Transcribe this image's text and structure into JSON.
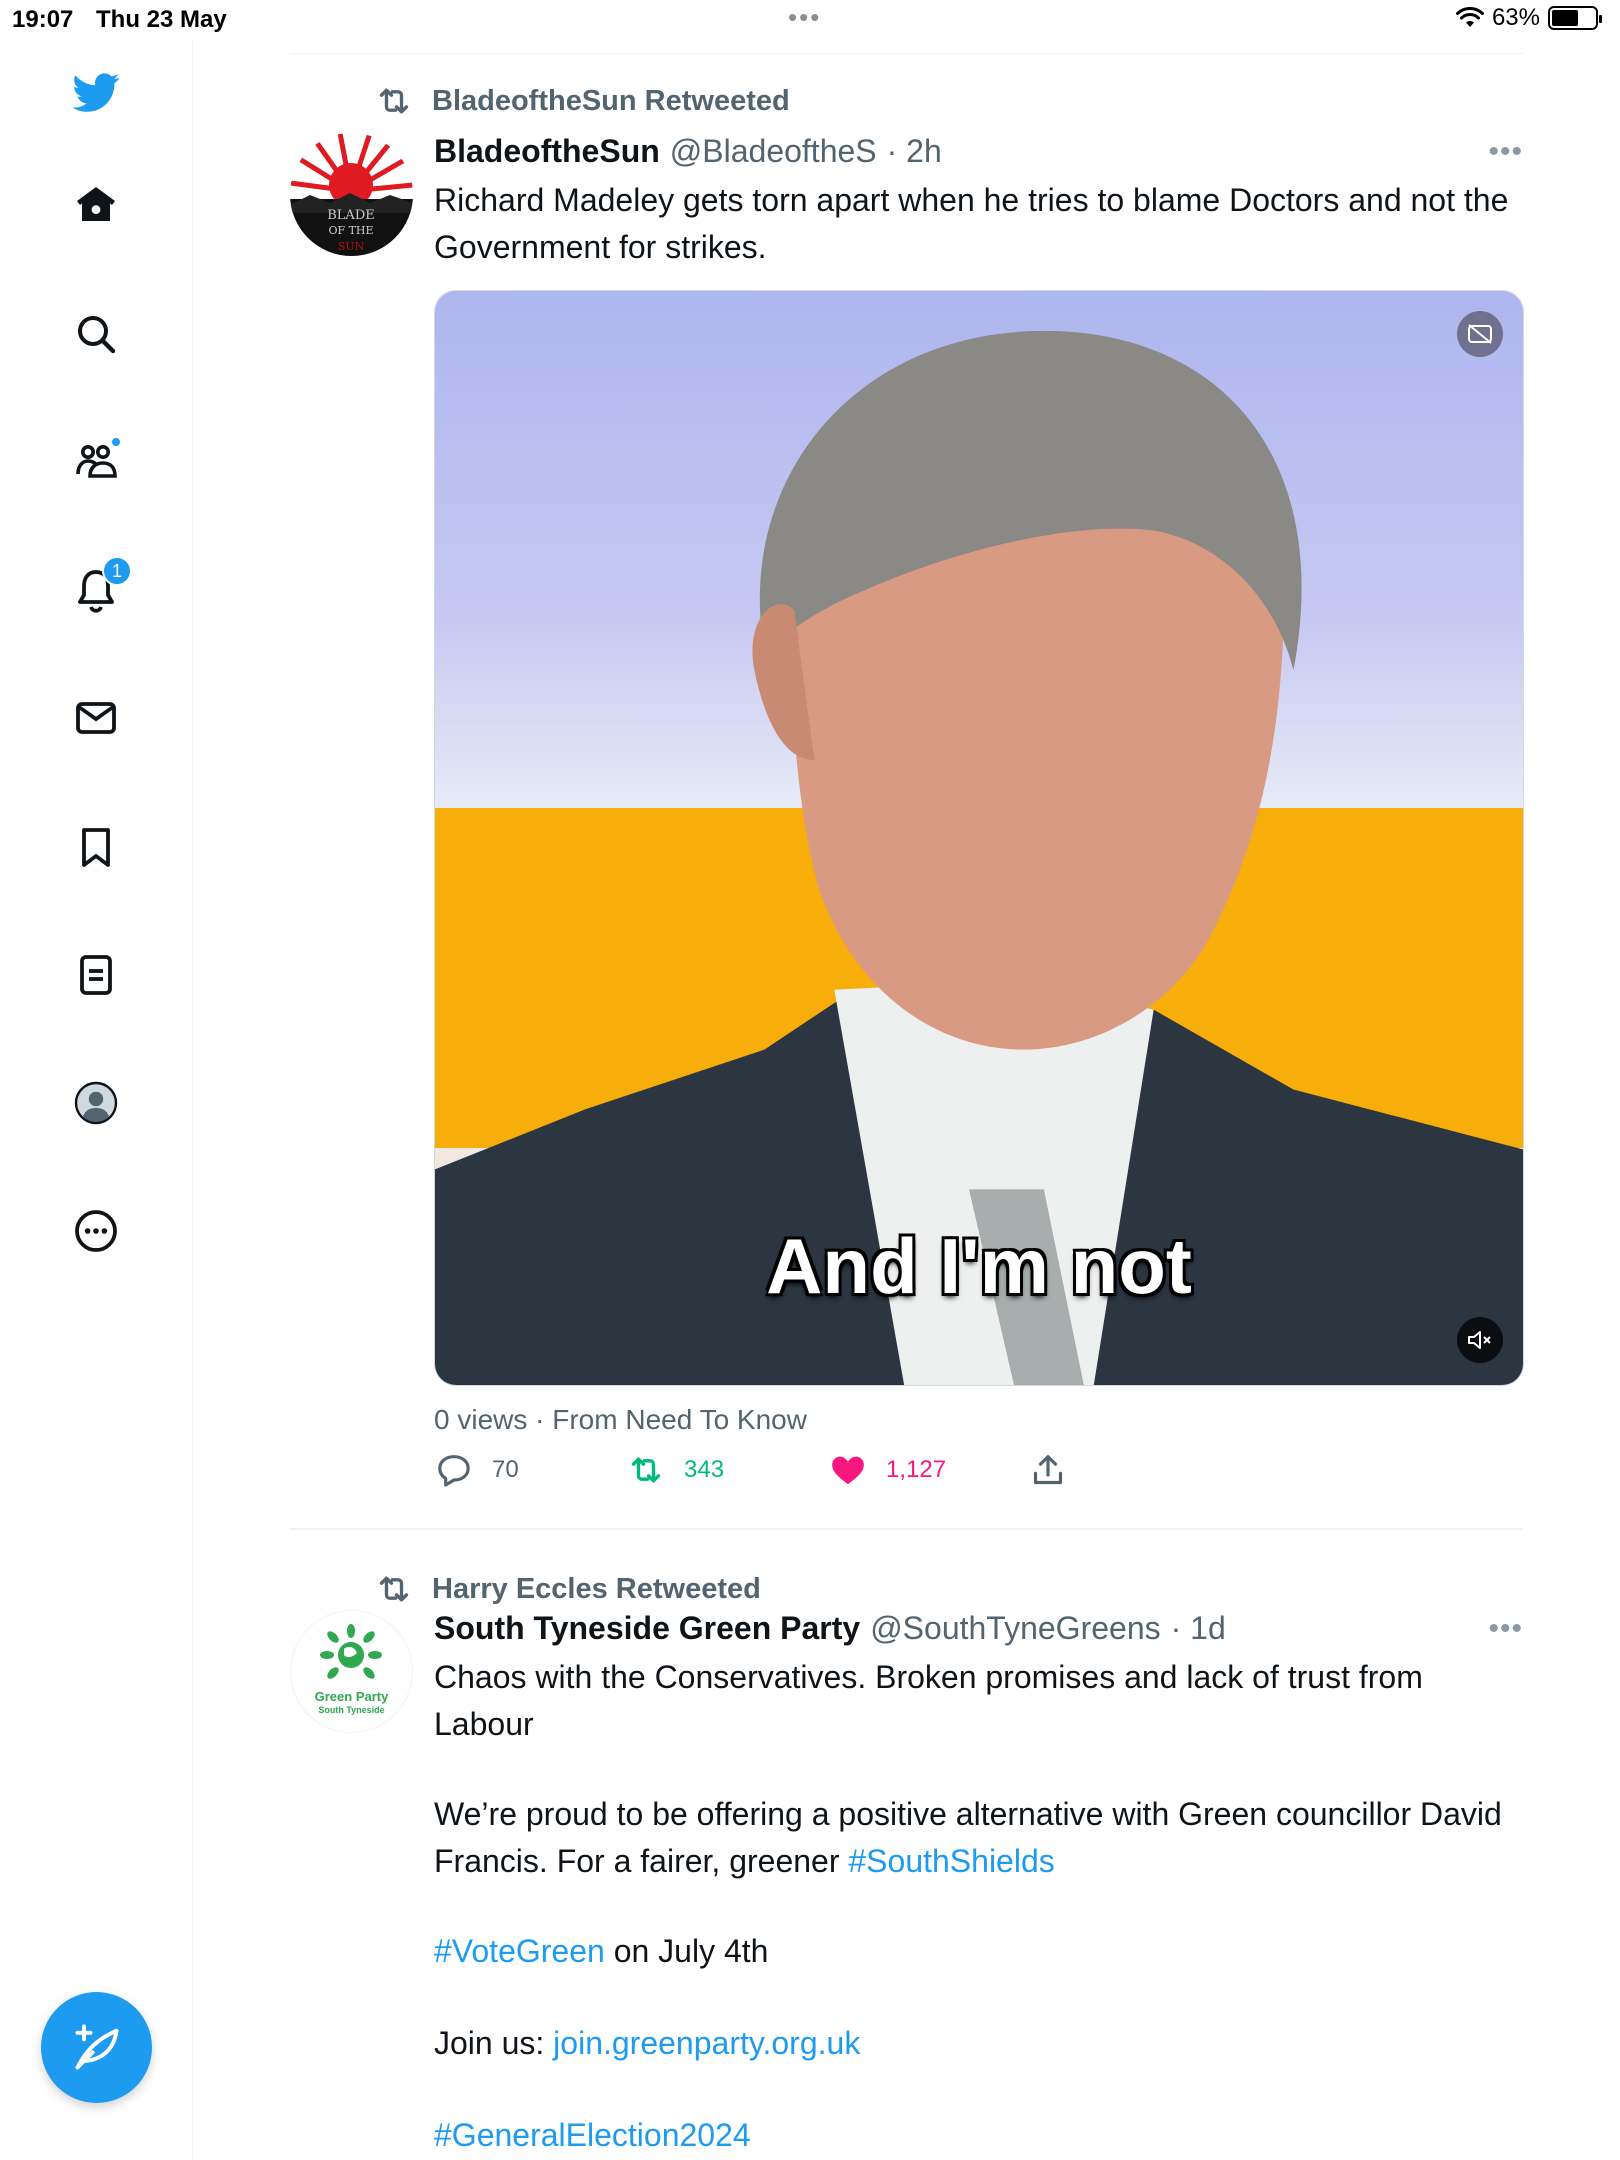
{
  "status_bar": {
    "time": "19:07",
    "date": "Thu 23 May",
    "dots": "•••",
    "battery": "63%"
  },
  "sidebar": {
    "items": [
      {
        "icon": "home-icon"
      },
      {
        "icon": "search-icon"
      },
      {
        "icon": "communities-icon"
      },
      {
        "icon": "notifications-icon",
        "badge": "1"
      },
      {
        "icon": "messages-icon"
      },
      {
        "icon": "bookmarks-icon"
      },
      {
        "icon": "lists-icon"
      },
      {
        "icon": "profile-icon"
      },
      {
        "icon": "more-icon"
      }
    ],
    "compose": "compose-icon"
  },
  "tweets": [
    {
      "retweeted_by": "BladeoftheSun Retweeted",
      "name": "BladeoftheSun",
      "handle": "@BladeoftheS",
      "time": "· 2h",
      "more": "•••",
      "text": "Richard Madeley gets torn apart when he tries to blame Doctors and not the Government for strikes.",
      "video_caption": "And I'm not",
      "meta": "0 views · From Need To Know",
      "replies": "70",
      "retweets": "343",
      "likes": "1,127"
    },
    {
      "retweeted_by": "Harry Eccles Retweeted",
      "name": "South Tyneside Green Party",
      "handle": "@SouthTyneGreens",
      "time": "· 1d",
      "more": "•••",
      "avatar_line1": "Green Party",
      "avatar_line2": "South Tyneside",
      "p1": "Chaos with the Conservatives. Broken promises and lack of trust from Labour",
      "p2": "We’re proud to be offering a positive alternative with Green councillor David Francis. For a fairer, greener ",
      "p2_tag": "#SouthShields",
      "p3_tag": "#VoteGreen",
      "p3_rest": " on July 4th",
      "p4": "Join us: ",
      "p4_link": "join.greenparty.org.uk",
      "p5_tag": "#GeneralElection2024"
    }
  ],
  "colors": {
    "accent": "#1d9bf0",
    "retweet": "#00ba7c",
    "like": "#f91880",
    "muted": "#536471"
  }
}
